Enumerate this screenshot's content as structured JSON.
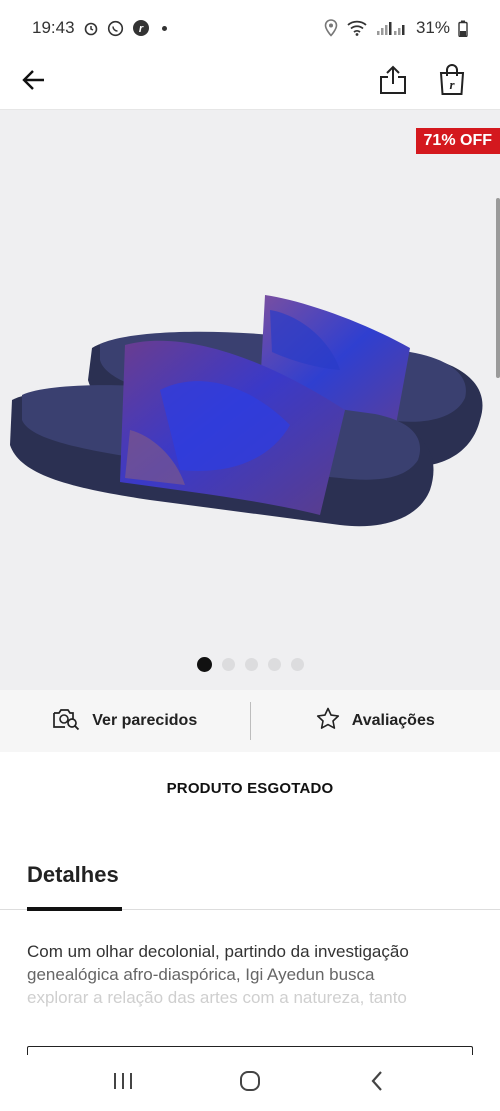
{
  "status_bar": {
    "time": "19:43",
    "battery": "31%",
    "icons": [
      "alarm-icon",
      "whatsapp-icon",
      "app-r-icon",
      "location-icon",
      "wifi-icon",
      "signal-icon",
      "battery-icon"
    ]
  },
  "header": {
    "back_icon": "back-arrow-icon",
    "share_icon": "share-icon",
    "bag_icon": "shopping-bag-icon"
  },
  "gallery": {
    "badge": "71% OFF",
    "image_count": 5,
    "active_index": 0
  },
  "actions": {
    "similar_label": "Ver parecidos",
    "reviews_label": "Avaliações"
  },
  "status_message": "PRODUTO ESGOTADO",
  "details": {
    "tab_label": "Detalhes",
    "lines": [
      "Com um olhar decolonial, partindo da investigação",
      "genealógica afro-diaspórica, Igi Ayedun busca",
      "explorar a relação das artes com a natureza, tanto"
    ]
  },
  "colors": {
    "badge_bg": "#d4181e",
    "accent": "#111111",
    "gallery_bg": "#efeff1"
  }
}
